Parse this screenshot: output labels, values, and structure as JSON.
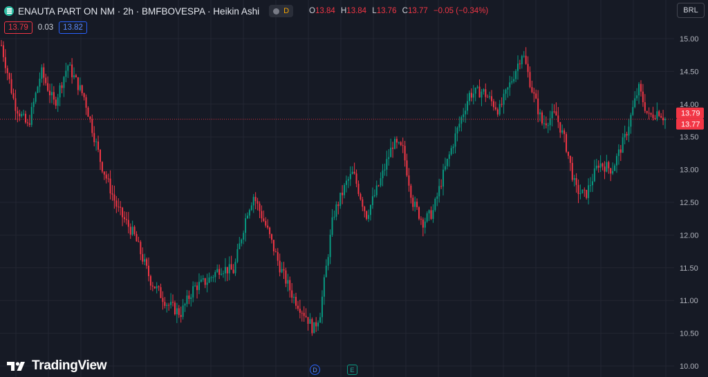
{
  "header": {
    "title": "ENAUTA PART ON NM · 2h · BMFBOVESPA · Heikin Ashi",
    "badge_letter": "D",
    "ohlc": {
      "o_label": "O",
      "o_value": "13.84",
      "h_label": "H",
      "h_value": "13.84",
      "l_label": "L",
      "l_value": "13.76",
      "c_label": "C",
      "c_value": "13.77",
      "change": "−0.05 (−0.34%)"
    }
  },
  "bidask": {
    "sell": "13.79",
    "spread": "0.03",
    "buy": "13.82"
  },
  "currency": "BRL",
  "logo_text": "TradingView",
  "events": [
    "D",
    "E"
  ],
  "colors": {
    "background": "#161a25",
    "grid": "#232632",
    "up": "#089981",
    "down": "#f23645",
    "axis_text": "#b2b5be",
    "price_line": "#f23645"
  },
  "chart_data": {
    "type": "candlestick",
    "chart_style": "Heikin Ashi",
    "symbol": "ENAUTA PART ON NM",
    "interval": "2h",
    "exchange": "BMFBOVESPA",
    "currency": "BRL",
    "ylim": [
      10.0,
      15.0
    ],
    "y_ticks": [
      "15.00",
      "14.50",
      "14.00",
      "13.50",
      "13.00",
      "12.50",
      "12.00",
      "11.50",
      "11.00",
      "10.50",
      "10.00"
    ],
    "price_labels": [
      {
        "value": 13.79,
        "text": "13.79"
      },
      {
        "value": 13.77,
        "text": "13.77"
      }
    ],
    "current_price": 13.77,
    "grid": true,
    "path_key_points": [
      [
        0,
        14.9
      ],
      [
        4,
        14.0
      ],
      [
        8,
        13.65
      ],
      [
        12,
        14.5
      ],
      [
        16,
        14.0
      ],
      [
        20,
        14.6
      ],
      [
        25,
        14.1
      ],
      [
        30,
        13.1
      ],
      [
        35,
        12.4
      ],
      [
        40,
        12.0
      ],
      [
        45,
        11.3
      ],
      [
        50,
        10.95
      ],
      [
        54,
        10.8
      ],
      [
        58,
        11.2
      ],
      [
        62,
        11.3
      ],
      [
        66,
        11.5
      ],
      [
        70,
        11.45
      ],
      [
        74,
        12.35
      ],
      [
        76,
        12.6
      ],
      [
        80,
        12.1
      ],
      [
        84,
        11.5
      ],
      [
        88,
        11.05
      ],
      [
        92,
        10.75
      ],
      [
        94,
        10.55
      ],
      [
        96,
        10.8
      ],
      [
        100,
        12.3
      ],
      [
        104,
        12.8
      ],
      [
        106,
        12.95
      ],
      [
        110,
        12.3
      ],
      [
        114,
        12.8
      ],
      [
        118,
        13.4
      ],
      [
        121,
        13.3
      ],
      [
        124,
        12.5
      ],
      [
        127,
        12.2
      ],
      [
        130,
        12.35
      ],
      [
        133,
        12.9
      ],
      [
        137,
        13.55
      ],
      [
        141,
        14.15
      ],
      [
        145,
        14.2
      ],
      [
        150,
        13.9
      ],
      [
        154,
        14.4
      ],
      [
        157,
        14.8
      ],
      [
        160,
        14.2
      ],
      [
        163,
        13.7
      ],
      [
        167,
        13.85
      ],
      [
        170,
        13.4
      ],
      [
        173,
        12.7
      ],
      [
        176,
        12.6
      ],
      [
        180,
        13.1
      ],
      [
        184,
        13.0
      ],
      [
        188,
        13.5
      ],
      [
        192,
        14.25
      ],
      [
        195,
        13.8
      ],
      [
        198,
        13.9
      ],
      [
        200,
        13.77
      ]
    ]
  }
}
